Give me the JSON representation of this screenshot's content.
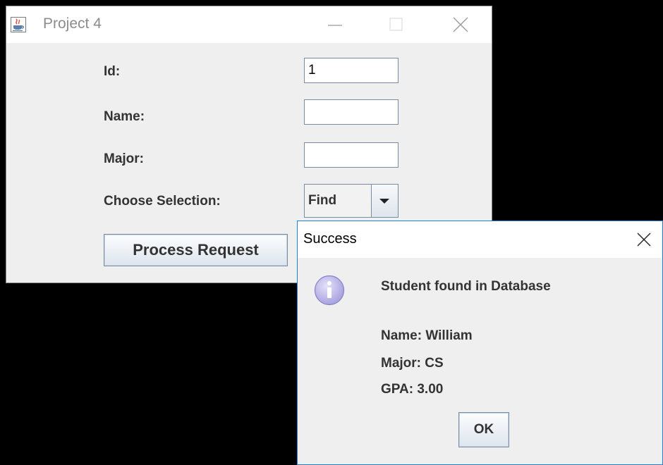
{
  "main_window": {
    "title": "Project 4",
    "app_icon": "java-icon",
    "window_controls": [
      "minimize-icon",
      "maximize-icon",
      "close-icon"
    ],
    "form": {
      "id_label": "Id:",
      "id_value": "1",
      "name_label": "Name:",
      "name_value": "",
      "major_label": "Major:",
      "major_value": "",
      "selection_label": "Choose Selection:",
      "selection_value": "Find"
    },
    "process_button_label": "Process Request"
  },
  "dialog": {
    "title": "Success",
    "icon": "info-icon",
    "message_heading": "Student found in Database",
    "name_line": "Name: William",
    "major_line": "Major: CS",
    "gpa_line": "GPA: 3.00",
    "ok_label": "OK"
  },
  "colors": {
    "desktop": "#000000",
    "window_bg": "#efefef",
    "dialog_border": "#1e7fd8",
    "label_text": "#333333",
    "info_icon_fill": "#b9b4e6"
  }
}
